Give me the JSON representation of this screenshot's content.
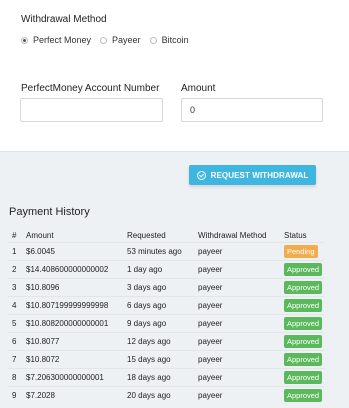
{
  "form": {
    "method_label": "Withdrawal Method",
    "methods": [
      {
        "label": "Perfect Money",
        "selected": true
      },
      {
        "label": "Payeer",
        "selected": false
      },
      {
        "label": "Bitcoin",
        "selected": false
      }
    ],
    "account_label": "PerfectMoney Account Number",
    "account_value": "",
    "amount_label": "Amount",
    "amount_value": "0",
    "submit_label": "REQUEST WITHDRAWAL"
  },
  "history": {
    "title": "Payment History",
    "columns": [
      "#",
      "Amount",
      "Requested",
      "Withdrawal Method",
      "Status"
    ],
    "rows": [
      {
        "n": "1",
        "amount": "$6.0045",
        "requested": "53 minutes ago",
        "method": "payeer",
        "status": "Pending"
      },
      {
        "n": "2",
        "amount": "$14.408600000000002",
        "requested": "1 day ago",
        "method": "payeer",
        "status": "Approved"
      },
      {
        "n": "3",
        "amount": "$10.8096",
        "requested": "3 days ago",
        "method": "payeer",
        "status": "Approved"
      },
      {
        "n": "4",
        "amount": "$10.807199999999998",
        "requested": "6 days ago",
        "method": "payeer",
        "status": "Approved"
      },
      {
        "n": "5",
        "amount": "$10.808200000000001",
        "requested": "9 days ago",
        "method": "payeer",
        "status": "Approved"
      },
      {
        "n": "6",
        "amount": "$10.8077",
        "requested": "12 days ago",
        "method": "payeer",
        "status": "Approved"
      },
      {
        "n": "7",
        "amount": "$10.8072",
        "requested": "15 days ago",
        "method": "payeer",
        "status": "Approved"
      },
      {
        "n": "8",
        "amount": "$7.206300000000001",
        "requested": "18 days ago",
        "method": "payeer",
        "status": "Approved"
      },
      {
        "n": "9",
        "amount": "$7.2028",
        "requested": "20 days ago",
        "method": "payeer",
        "status": "Approved"
      }
    ]
  },
  "colors": {
    "accent": "#3eb6e0",
    "approved": "#5cb85c",
    "pending": "#f0ad4e"
  }
}
